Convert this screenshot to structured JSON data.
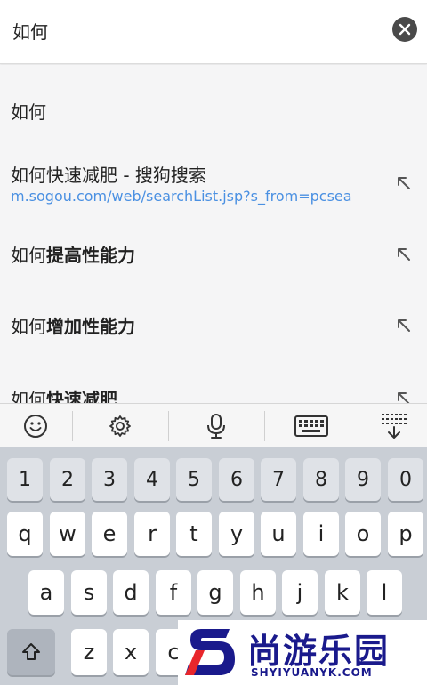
{
  "search": {
    "query": "如何"
  },
  "suggestions": [
    {
      "prefix": "如何",
      "bold": ""
    },
    {
      "prefix": "如何快速减肥 - 搜狗搜索",
      "bold": "",
      "url": "m.sogou.com/web/searchList.jsp?s_from=pcsea"
    },
    {
      "prefix": "如何",
      "bold": "提高性能力"
    },
    {
      "prefix": "如何",
      "bold": "增加性能力"
    },
    {
      "prefix": "如何",
      "bold": "快速减肥"
    }
  ],
  "toolbar": {
    "icons": [
      "emoji-icon",
      "gear-icon",
      "microphone-icon",
      "keyboard-icon",
      "collapse-keyboard-icon"
    ]
  },
  "keyboard": {
    "number_row": [
      "1",
      "2",
      "3",
      "4",
      "5",
      "6",
      "7",
      "8",
      "9",
      "0"
    ],
    "row1": [
      "q",
      "w",
      "e",
      "r",
      "t",
      "y",
      "u",
      "i",
      "o",
      "p"
    ],
    "row2": [
      "a",
      "s",
      "d",
      "f",
      "g",
      "h",
      "j",
      "k",
      "l"
    ],
    "row3": [
      "z",
      "x",
      "c"
    ]
  },
  "watermark": {
    "title": "尚游乐园",
    "subtitle": "SHYIYUANYK.COM"
  },
  "colors": {
    "link": "#4a90e2",
    "keyboard_bg": "#c9ced5",
    "watermark": "#1a1a8c"
  }
}
